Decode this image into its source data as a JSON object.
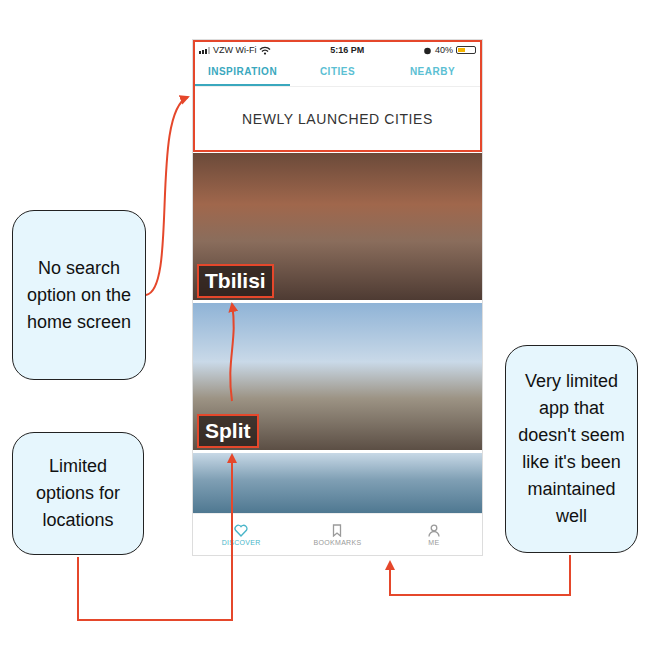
{
  "status_bar": {
    "carrier": "VZW Wi-Fi",
    "time": "5:16 PM",
    "battery": "40%",
    "battery_level": 0.4
  },
  "tabs": [
    {
      "label": "INSPIRATION",
      "selected": true
    },
    {
      "label": "CITIES",
      "selected": false
    },
    {
      "label": "NEARBY",
      "selected": false
    }
  ],
  "section_title": "NEWLY LAUNCHED CITIES",
  "cities": [
    {
      "name": "Tbilisi",
      "highlighted": true
    },
    {
      "name": "Split",
      "highlighted": true
    },
    {
      "name": "",
      "highlighted": false
    }
  ],
  "bottom_nav": [
    {
      "label": "DISCOVER",
      "selected": true
    },
    {
      "label": "BOOKMARKS",
      "selected": false
    },
    {
      "label": "ME",
      "selected": false
    }
  ],
  "annotations": [
    {
      "text": "No search option on the home screen"
    },
    {
      "text": "Limited options for locations"
    },
    {
      "text": "Very limited app that doesn't seem like it's been maintained well"
    }
  ]
}
